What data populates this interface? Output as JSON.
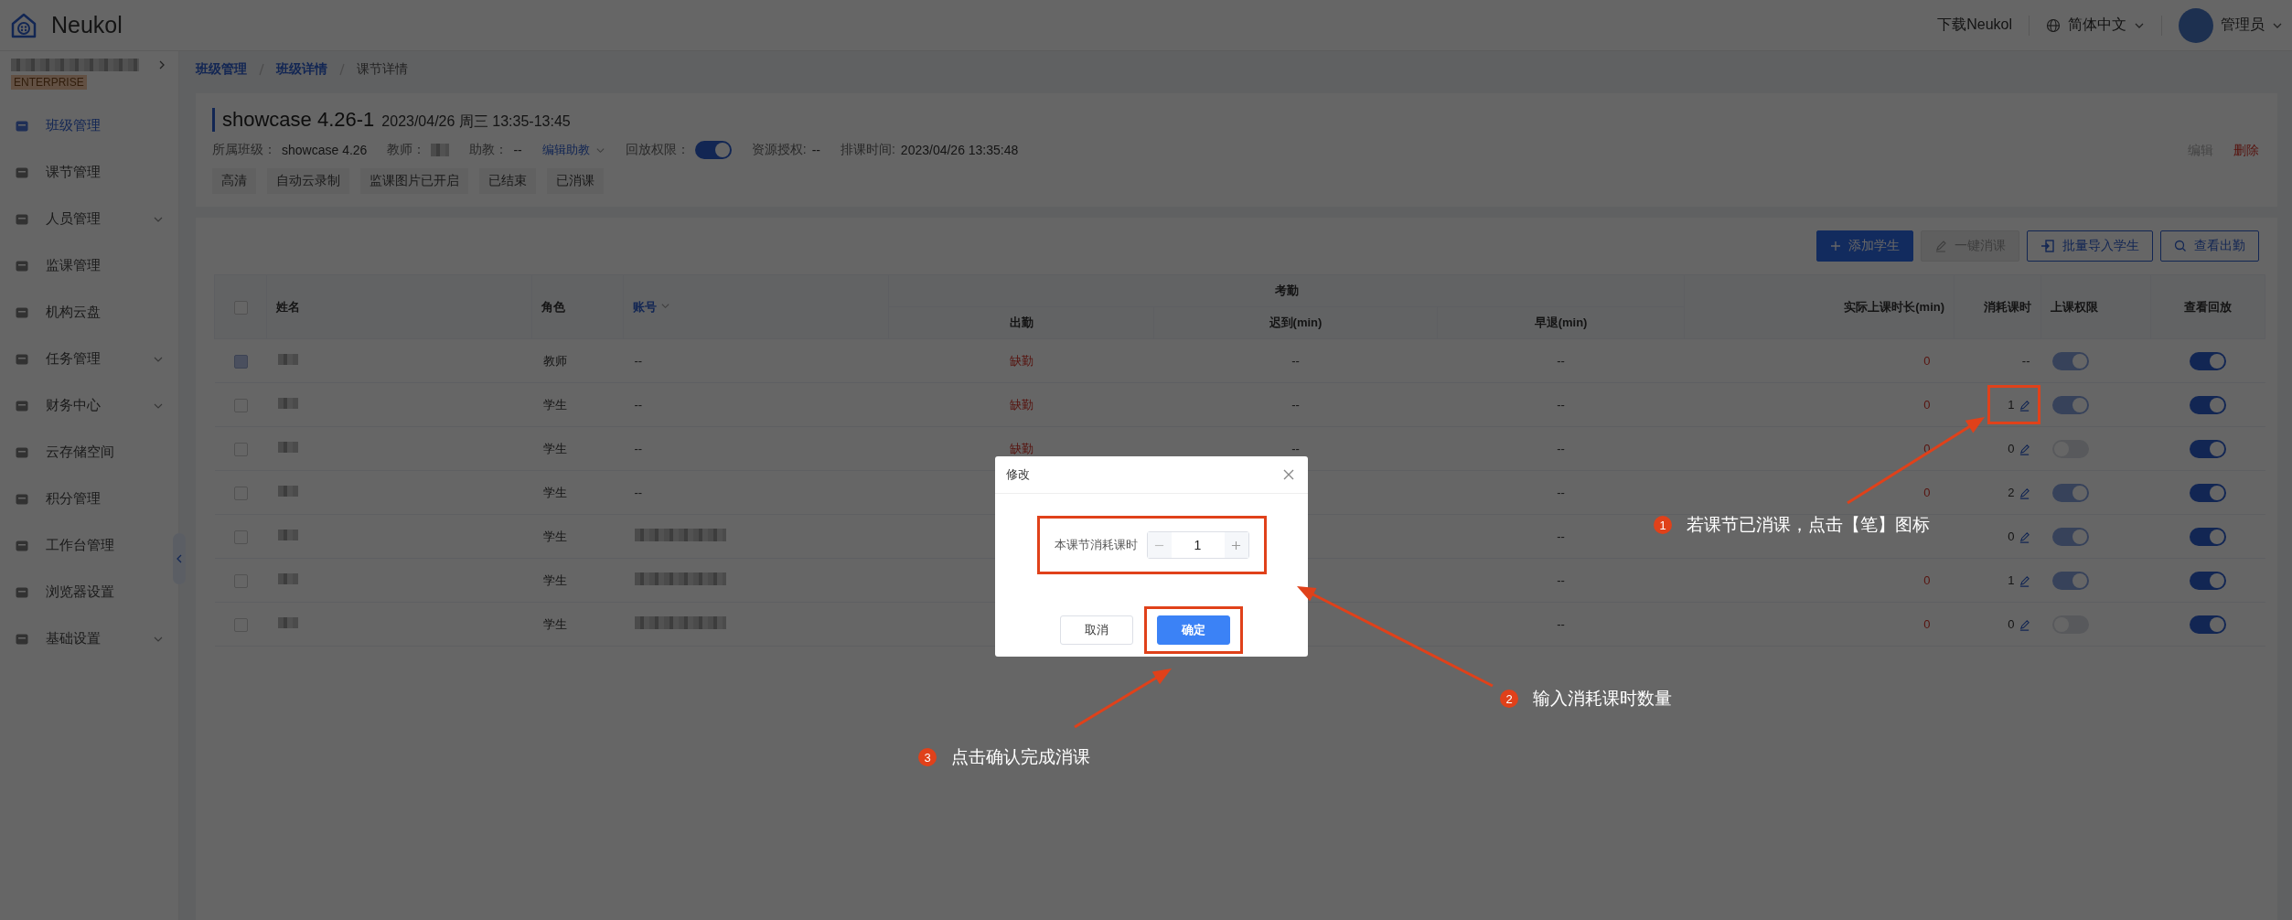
{
  "header": {
    "logo_text": "Neukol",
    "download": "下载Neukol",
    "language": "简体中文",
    "user": "管理员"
  },
  "sidebar": {
    "org_badge": "ENTERPRISE",
    "items": [
      {
        "label": "班级管理",
        "selected": true,
        "expandable": false
      },
      {
        "label": "课节管理",
        "selected": false,
        "expandable": false
      },
      {
        "label": "人员管理",
        "selected": false,
        "expandable": true
      },
      {
        "label": "监课管理",
        "selected": false,
        "expandable": false
      },
      {
        "label": "机构云盘",
        "selected": false,
        "expandable": false
      },
      {
        "label": "任务管理",
        "selected": false,
        "expandable": true
      },
      {
        "label": "财务中心",
        "selected": false,
        "expandable": true
      },
      {
        "label": "云存储空间",
        "selected": false,
        "expandable": false
      },
      {
        "label": "积分管理",
        "selected": false,
        "expandable": false
      },
      {
        "label": "工作台管理",
        "selected": false,
        "expandable": false
      },
      {
        "label": "浏览器设置",
        "selected": false,
        "expandable": false
      },
      {
        "label": "基础设置",
        "selected": false,
        "expandable": true
      }
    ]
  },
  "breadcrumb": [
    {
      "label": "班级管理",
      "kind": "link"
    },
    {
      "label": "班级详情",
      "kind": "link"
    },
    {
      "label": "课节详情",
      "kind": "current"
    }
  ],
  "lesson": {
    "title": "showcase 4.26-1",
    "time": "2023/04/26 周三 13:35-13:45",
    "fields": [
      {
        "kind": "text",
        "label": "所属班级：",
        "value": "showcase 4.26"
      },
      {
        "kind": "redacted",
        "label": "教师："
      },
      {
        "kind": "text",
        "label": "助教：",
        "value": "--"
      },
      {
        "kind": "link",
        "label": "编辑助教"
      },
      {
        "kind": "toggle",
        "label": "回放权限：",
        "on": true
      },
      {
        "kind": "text",
        "label": "资源授权:",
        "value": "--"
      },
      {
        "kind": "text",
        "label": "排课时间:",
        "value": "2023/04/26 13:35:48"
      }
    ],
    "tags": [
      "高清",
      "自动云录制",
      "监课图片已开启",
      "已结束",
      "已消课"
    ],
    "actions": [
      {
        "label": "编辑",
        "kind": "muted"
      },
      {
        "label": "删除",
        "kind": "danger"
      }
    ]
  },
  "toolbar": [
    {
      "label": "添加学生",
      "kind": "primary"
    },
    {
      "label": "一键消课",
      "kind": "disabled"
    },
    {
      "label": "批量导入学生",
      "kind": "outline"
    },
    {
      "label": "查看出勤",
      "kind": "outline"
    }
  ],
  "table": {
    "headers": {
      "name": "姓名",
      "role": "角色",
      "account": "账号",
      "attendance_group": "考勤",
      "attendance": "出勤",
      "late": "迟到(min)",
      "early": "早退(min)",
      "duration": "实际上课时长(min)",
      "consumed": "消耗课时",
      "permission": "上课权限",
      "replay": "查看回放"
    },
    "select_all_checked": false,
    "rows": [
      {
        "checkbox_disabled": true,
        "role": "教师",
        "account": "--",
        "attendance": "缺勤",
        "late": "--",
        "early": "--",
        "duration": "0",
        "consumed": "--",
        "editable": false,
        "highlighted": false,
        "class_permission": true,
        "replay": true
      },
      {
        "checkbox_disabled": false,
        "role": "学生",
        "account": "--",
        "attendance": "缺勤",
        "late": "--",
        "early": "--",
        "duration": "0",
        "consumed": "1",
        "editable": true,
        "highlighted": true,
        "class_permission": true,
        "replay": true
      },
      {
        "checkbox_disabled": false,
        "role": "学生",
        "account": "--",
        "attendance": "缺勤",
        "late": "--",
        "early": "--",
        "duration": "0",
        "consumed": "0",
        "editable": true,
        "highlighted": false,
        "class_permission": false,
        "replay": true
      },
      {
        "checkbox_disabled": false,
        "role": "学生",
        "account": "--",
        "early": "--",
        "duration": "0",
        "consumed": "2",
        "editable": true,
        "highlighted": false,
        "class_permission": true,
        "replay": true
      },
      {
        "checkbox_disabled": false,
        "role": "学生",
        "account_redacted": true,
        "early": "--",
        "consumed": "0",
        "editable": true,
        "highlighted": false,
        "class_permission": true,
        "replay": true
      },
      {
        "checkbox_disabled": false,
        "role": "学生",
        "account_redacted": true,
        "early": "--",
        "duration": "0",
        "consumed": "1",
        "editable": true,
        "highlighted": false,
        "class_permission": true,
        "replay": true
      },
      {
        "checkbox_disabled": false,
        "role": "学生",
        "account_redacted": true,
        "early": "--",
        "duration": "0",
        "consumed": "0",
        "editable": true,
        "highlighted": false,
        "class_permission": false,
        "replay": true
      }
    ]
  },
  "dialog": {
    "title": "修改",
    "label": "本课节消耗课时",
    "value": "1",
    "buttons": [
      {
        "label": "取消",
        "kind": "default"
      },
      {
        "label": "确定",
        "kind": "primary"
      }
    ]
  },
  "annotations": [
    {
      "number": "1",
      "text": "若课节已消课，点击【笔】图标"
    },
    {
      "number": "2",
      "text": "输入消耗课时数量"
    },
    {
      "number": "3",
      "text": "点击确认完成消课"
    }
  ]
}
